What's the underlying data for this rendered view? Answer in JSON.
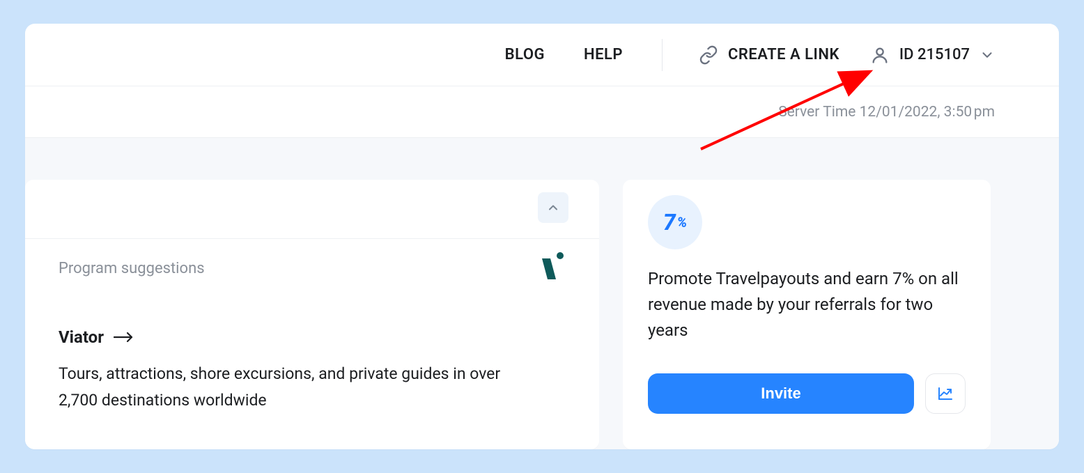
{
  "header": {
    "blog_label": "BLOG",
    "help_label": "HELP",
    "create_link_label": "CREATE A LINK",
    "user_id_label": "ID 215107"
  },
  "subheader": {
    "server_time_label": "Server Time 12/01/2022, 3:50 pm"
  },
  "suggestions": {
    "section_label": "Program suggestions",
    "program_name": "Viator",
    "program_desc": "Tours, attractions, shore excursions, and private guides in over 2,700 destinations worldwide"
  },
  "promo": {
    "badge_number": "7",
    "badge_pct": "%",
    "text": "Promote Travelpayouts and earn 7% on all revenue made by your referrals for two years",
    "invite_label": "Invite"
  }
}
